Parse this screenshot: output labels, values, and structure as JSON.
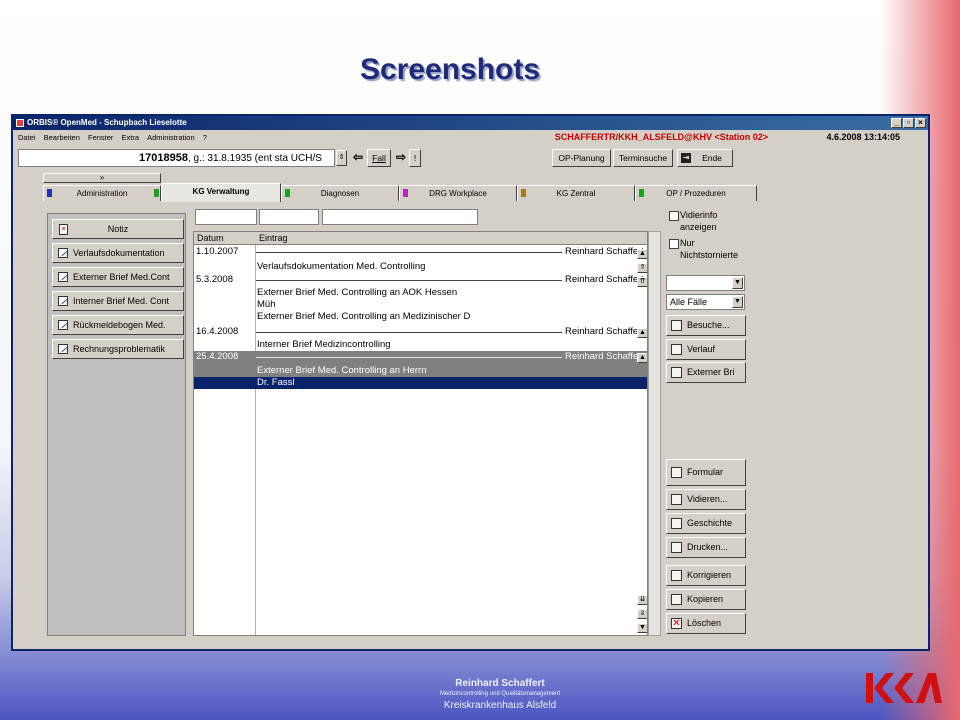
{
  "slide_title": "Screenshots",
  "window": {
    "title": "ORBIS® OpenMed - Schupbach Lieselotte"
  },
  "menu": [
    "Datei",
    "Bearbeiten",
    "Fenster",
    "Extra",
    "Administration",
    "?"
  ],
  "user_info": "SCHAFFERTR/KKH_ALSFELD@KHV <Station 02>",
  "datetime": "4.6.2008 13:14:05",
  "patient": {
    "id": "17018958",
    "info": ", g.: 31.8.1935 (ent sta UCH/S"
  },
  "toolbar": {
    "fall": "Fall",
    "excl": "!",
    "op_planung": "OP-Planung",
    "terminsuche": "Terminsuche",
    "ende": "Ende"
  },
  "collapse": "»",
  "tabs": [
    {
      "label": "Administration",
      "flag": "#2030c0"
    },
    {
      "label": "KG Verwaltung",
      "flag": "#20a020"
    },
    {
      "label": "Diagnosen",
      "flag": "#20a020"
    },
    {
      "label": "DRG Workplace",
      "flag": "#c020c0"
    },
    {
      "label": "KG Zentral",
      "flag": "#a08000"
    },
    {
      "label": "OP / Prozeduren",
      "flag": "#20a020"
    }
  ],
  "left_buttons": [
    "Notiz",
    "Verlaufsdokumentation",
    "Externer Brief Med.Cont",
    "Interner Brief Med. Cont",
    "Rückmeldebogen Med.",
    "Rechnungsproblematik"
  ],
  "grid": {
    "headers": [
      "Datum",
      "Eintrag"
    ],
    "rows": [
      {
        "date": "1.10.2007",
        "author": "Reinhard Schaffert",
        "lines": [
          "Verlaufsdokumentation Med. Controlling"
        ]
      },
      {
        "date": "5.3.2008",
        "author": "Reinhard Schaffert",
        "lines": [
          "Externer Brief Med. Controlling an AOK Hessen",
          "Müh",
          "Externer Brief Med. Controlling an Medizinischer D"
        ]
      },
      {
        "date": "16.4.2008",
        "author": "Reinhard Schaffert",
        "lines": [
          "Interner Brief Medizincontrolling"
        ]
      },
      {
        "date": "25.4.2008",
        "author": "Reinhard Schaffert",
        "lines": [
          "Externer Brief Med. Controlling an Herrn",
          "Dr. Fassl"
        ]
      }
    ]
  },
  "right": {
    "chk1": "Vidierinfo anzeigen",
    "chk2": "Nur Nichtstornierte",
    "select2": "Alle Fälle",
    "buttons": [
      "Besuche...",
      "Verlauf",
      "Externer Bri",
      "Formular",
      "Vidieren...",
      "Geschichte",
      "Drucken...",
      "Korrigieren",
      "Kopieren",
      "Löschen"
    ]
  },
  "footer": {
    "name": "Reinhard Schaffert",
    "dept": "Medizincontrolling  und Qualitätsmanagement",
    "org": "Kreiskrankenhaus Alsfeld"
  }
}
